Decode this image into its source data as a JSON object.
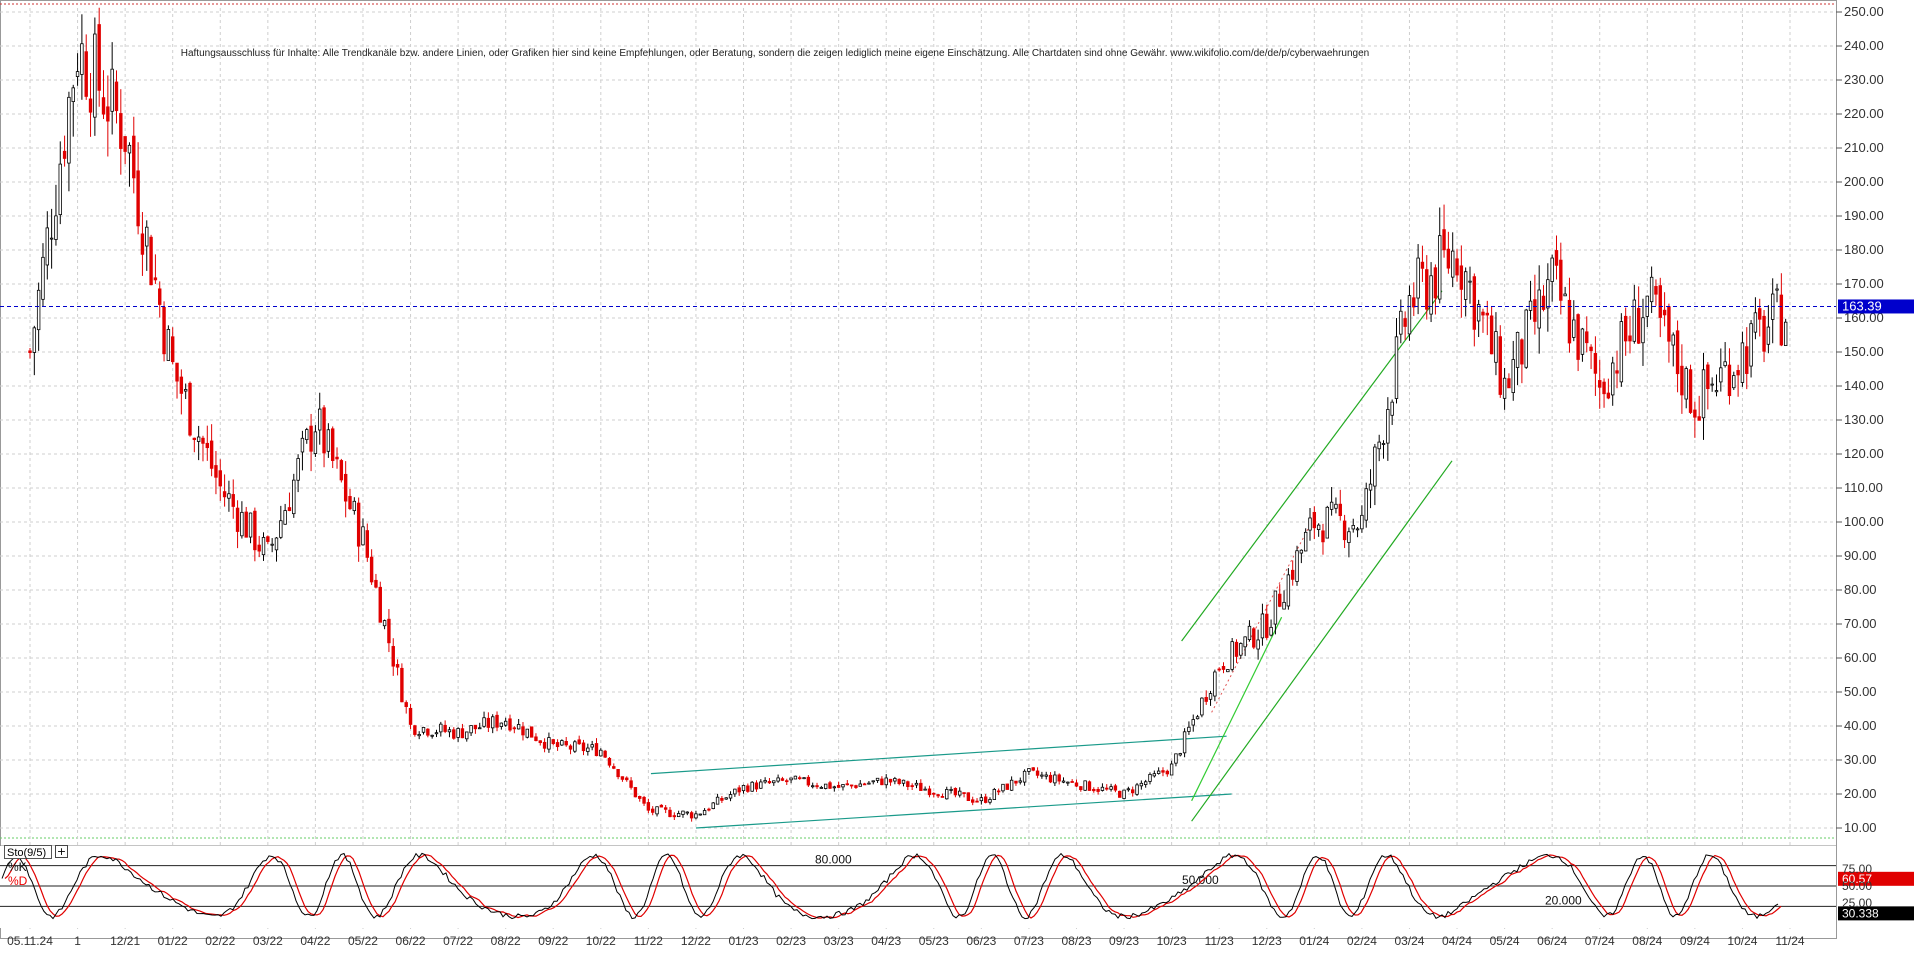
{
  "chart": {
    "disclaimer": "Haftungsausschluss für Inhalte: Alle Trendkanäle bzw. andere Linien, oder Grafiken hier sind keine Empfehlungen, oder Beratung, sondern die zeigen lediglich meine eigene Einschätzung. Alle Chartdaten sind ohne Gewähr. www.wikifolio.com/de/de/p/cyberwaehrungen",
    "last_price_label": "163.39",
    "indicator_name": "Sto(9/5)",
    "indicator_toggle": "+",
    "k_label": "%K",
    "d_label": "%D",
    "k_value_label": "60.57",
    "d_value_label": "30.338",
    "level_80_label": "80.000",
    "level_50_label": "50.000",
    "level_20_label": "20.000",
    "colors": {
      "up_candle": "#000000",
      "down_candle": "#e00000",
      "last_price": "#0000cc",
      "trend_green": "#22aa22",
      "channel_teal": "#1a9a8a",
      "stoch_k": "#000000",
      "stoch_d": "#e00000"
    }
  },
  "chart_data": [
    {
      "type": "candlestick",
      "x_ticks": [
        "05.11.24",
        "1",
        "12/21",
        "01/22",
        "02/22",
        "03/22",
        "04/22",
        "05/22",
        "06/22",
        "07/22",
        "08/22",
        "09/22",
        "10/22",
        "11/22",
        "12/22",
        "01/23",
        "02/23",
        "03/23",
        "04/23",
        "05/23",
        "06/23",
        "07/23",
        "08/23",
        "09/23",
        "10/23",
        "11/23",
        "12/23",
        "01/24",
        "02/24",
        "03/24",
        "04/24",
        "05/24",
        "06/24",
        "07/24",
        "08/24",
        "09/24",
        "10/24",
        "11/24"
      ],
      "y_ticks": [
        "250.00",
        "240.00",
        "230.00",
        "220.00",
        "210.00",
        "200.00",
        "190.00",
        "180.00",
        "170.00",
        "160.00",
        "150.00",
        "140.00",
        "130.00",
        "120.00",
        "110.00",
        "100.00",
        "90.00",
        "80.00",
        "70.00",
        "60.00",
        "50.00",
        "40.00",
        "30.00",
        "20.00",
        "10.00"
      ],
      "ylim": [
        5,
        252
      ],
      "grid": true,
      "last_price": 163.39,
      "close_series_by_month": [
        {
          "x": "11/21",
          "y": 150
        },
        {
          "x": "11/21",
          "y": 240
        },
        {
          "x": "12/21",
          "y": 215
        },
        {
          "x": "01/22",
          "y": 145
        },
        {
          "x": "02/22",
          "y": 110
        },
        {
          "x": "03/22",
          "y": 90
        },
        {
          "x": "04/22",
          "y": 130
        },
        {
          "x": "05/22",
          "y": 95
        },
        {
          "x": "06/22",
          "y": 40
        },
        {
          "x": "07/22",
          "y": 38
        },
        {
          "x": "08/22",
          "y": 42
        },
        {
          "x": "09/22",
          "y": 34
        },
        {
          "x": "10/22",
          "y": 33
        },
        {
          "x": "11/22",
          "y": 15
        },
        {
          "x": "12/22",
          "y": 14
        },
        {
          "x": "01/23",
          "y": 22
        },
        {
          "x": "02/23",
          "y": 24
        },
        {
          "x": "03/23",
          "y": 22
        },
        {
          "x": "04/23",
          "y": 24
        },
        {
          "x": "05/23",
          "y": 21
        },
        {
          "x": "06/23",
          "y": 18
        },
        {
          "x": "07/23",
          "y": 26
        },
        {
          "x": "08/23",
          "y": 23
        },
        {
          "x": "09/23",
          "y": 20
        },
        {
          "x": "10/23",
          "y": 28
        },
        {
          "x": "11/23",
          "y": 58
        },
        {
          "x": "12/23",
          "y": 70
        },
        {
          "x": "01/24",
          "y": 100
        },
        {
          "x": "02/24",
          "y": 100
        },
        {
          "x": "03/24",
          "y": 165
        },
        {
          "x": "04/24",
          "y": 180
        },
        {
          "x": "05/24",
          "y": 140
        },
        {
          "x": "06/24",
          "y": 170
        },
        {
          "x": "07/24",
          "y": 140
        },
        {
          "x": "08/24",
          "y": 165
        },
        {
          "x": "09/24",
          "y": 135
        },
        {
          "x": "10/24",
          "y": 150
        },
        {
          "x": "11/24",
          "y": 163.39
        }
      ],
      "trend_channel_2024": {
        "from": "10/23",
        "to": "04/24"
      },
      "consolidation_channel": {
        "from": "12/22",
        "to": "10/23",
        "lower": [
          10,
          20
        ],
        "upper": [
          26,
          37
        ]
      }
    },
    {
      "type": "line",
      "name": "Sto(9/5)",
      "series": [
        {
          "name": "%K",
          "last": 60.57
        },
        {
          "name": "%D",
          "last": 30.338
        }
      ],
      "levels": [
        80,
        50,
        20
      ],
      "ylim": [
        0,
        100
      ]
    }
  ]
}
